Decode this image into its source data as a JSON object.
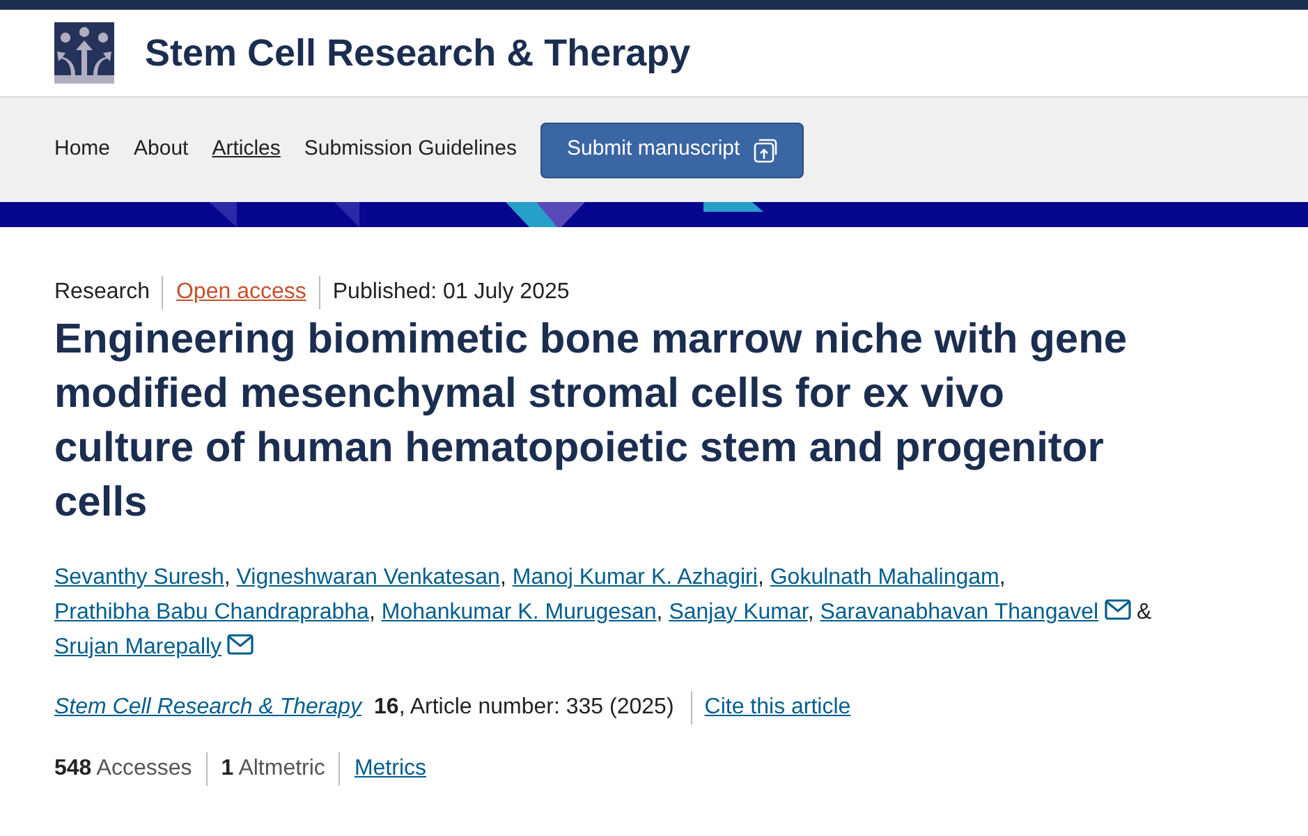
{
  "journal": {
    "title": "Stem Cell Research & Therapy"
  },
  "nav": {
    "items": [
      {
        "label": "Home",
        "selected": false
      },
      {
        "label": "About",
        "selected": false
      },
      {
        "label": "Articles",
        "selected": true
      },
      {
        "label": "Submission Guidelines",
        "selected": false
      }
    ],
    "submit_button": "Submit manuscript"
  },
  "article": {
    "type": "Research",
    "access": "Open access",
    "published": "Published: 01 July 2025",
    "title": "Engineering biomimetic bone marrow niche with gene modified mesenchymal stromal cells for ex vivo culture of human hematopoietic stem and progenitor cells",
    "authors": [
      {
        "name": "Sevanthy Suresh",
        "email": false
      },
      {
        "name": "Vigneshwaran Venkatesan",
        "email": false
      },
      {
        "name": "Manoj Kumar K. Azhagiri",
        "email": false
      },
      {
        "name": "Gokulnath Mahalingam",
        "email": false
      },
      {
        "name": "Prathibha Babu Chandraprabha",
        "email": false
      },
      {
        "name": "Mohankumar K. Murugesan",
        "email": false
      },
      {
        "name": "Sanjay Kumar",
        "email": false
      },
      {
        "name": "Saravanabhavan Thangavel",
        "email": true
      },
      {
        "name": "Srujan Marepally",
        "email": true
      }
    ],
    "author_separator": ",",
    "author_last_separator": "&",
    "journal_link": "Stem Cell Research & Therapy",
    "volume": "16",
    "article_number": ", Article number: 335 (2025)",
    "cite_link": "Cite this article",
    "metrics": [
      "**548** Accesses",
      "**1** Altmetric"
    ],
    "metrics_link": "Metrics"
  }
}
